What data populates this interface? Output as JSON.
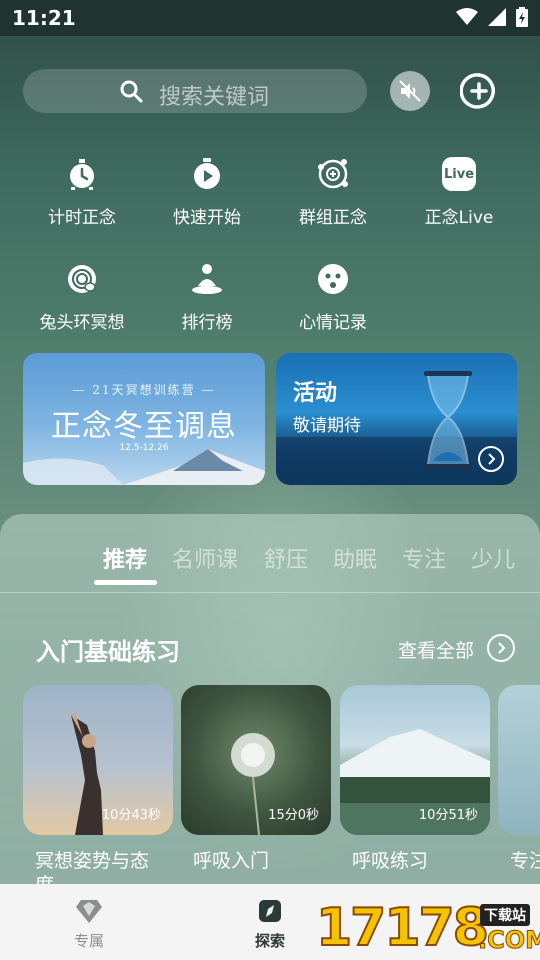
{
  "status_bar": {
    "time": "11:21"
  },
  "search": {
    "placeholder": "搜索关键词"
  },
  "quick_actions": [
    {
      "label": "计时正念",
      "icon": "timer-icon"
    },
    {
      "label": "快速开始",
      "icon": "quick-start-icon"
    },
    {
      "label": "群组正念",
      "icon": "group-icon"
    },
    {
      "label": "正念Live",
      "icon": "live-icon",
      "icon_text": "Live"
    },
    {
      "label": "兔头环冥想",
      "icon": "bunny-ring-icon"
    },
    {
      "label": "排行榜",
      "icon": "leaderboard-icon"
    },
    {
      "label": "心情记录",
      "icon": "mood-icon"
    }
  ],
  "banners": {
    "left": {
      "subtitle": "— 21天冥想训练营 —",
      "title": "正念冬至调息",
      "dates": "12.5-12.26"
    },
    "right": {
      "title": "活动",
      "subtitle": "敬请期待"
    }
  },
  "tabs": [
    {
      "label": "推荐",
      "active": true
    },
    {
      "label": "名师课",
      "active": false
    },
    {
      "label": "舒压",
      "active": false
    },
    {
      "label": "助眠",
      "active": false
    },
    {
      "label": "专注",
      "active": false
    },
    {
      "label": "少儿",
      "active": false
    }
  ],
  "section": {
    "title": "入门基础练习",
    "view_all": "查看全部"
  },
  "cards": [
    {
      "duration": "10分43秒",
      "title": "冥想姿势与态",
      "title_line2": "度"
    },
    {
      "duration": "15分0秒",
      "title": "呼吸入门"
    },
    {
      "duration": "10分51秒",
      "title": "呼吸练习"
    },
    {
      "duration": "",
      "title": "专注"
    }
  ],
  "bottom_nav": [
    {
      "label": "专属",
      "icon": "diamond-icon",
      "active": false
    },
    {
      "label": "探索",
      "icon": "compass-icon",
      "active": true
    }
  ],
  "watermark": {
    "text": "17178",
    "badge": "下载站",
    "suffix": ".COM"
  },
  "colors": {
    "accent": "#2f5a52",
    "nav_active": "#2b3a38",
    "nav_inactive": "#8a8f8e"
  }
}
